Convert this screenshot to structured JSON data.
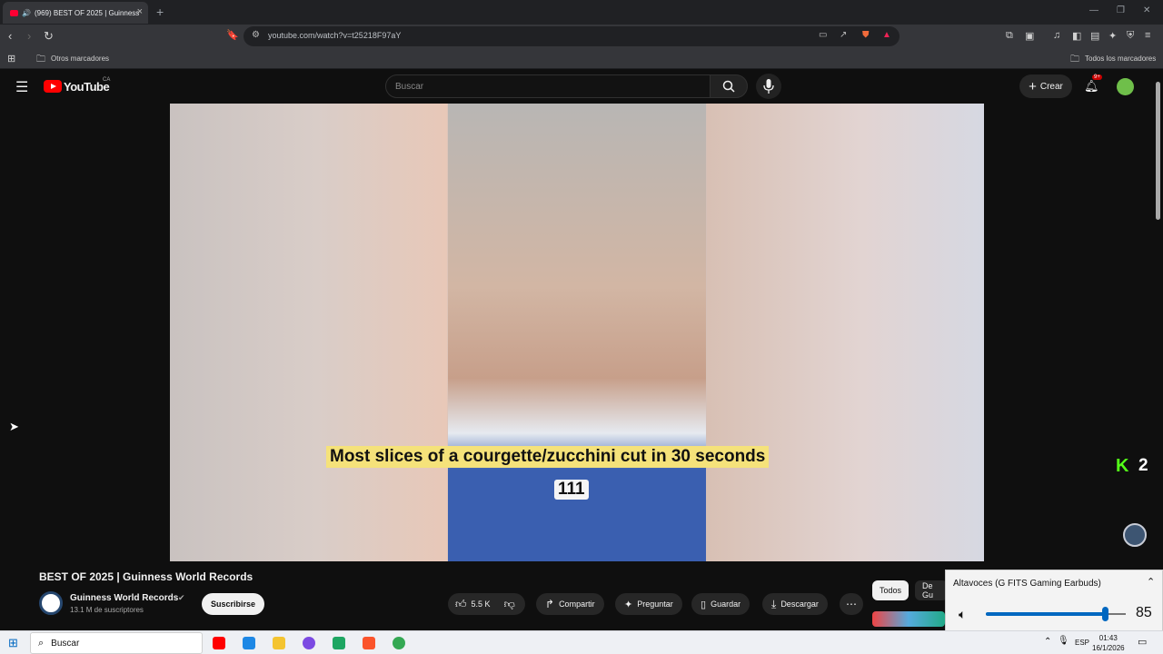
{
  "browser": {
    "tab_title": "(969) BEST OF 2025 | Guinness",
    "url": "youtube.com/watch?v=t25218F97aY",
    "bookmark_other": "Otros marcadores",
    "bookmark_all": "Todos los marcadores"
  },
  "youtube": {
    "logo_text": "YouTube",
    "region": "CA",
    "search_placeholder": "Buscar",
    "create_label": "Crear",
    "notif_badge": "9+"
  },
  "video": {
    "caption": "Most slices of a courgette/zucchini cut in 30 seconds",
    "counter": "111",
    "overlay_k": "K",
    "overlay_num": "2"
  },
  "info": {
    "title": "BEST OF 2025 | Guinness World Records",
    "channel": "Guinness World Records",
    "subs": "13.1 M de suscriptores",
    "subscribe": "Suscribirse",
    "likes": "5.5 K",
    "share": "Compartir",
    "ask": "Preguntar",
    "save": "Guardar",
    "download": "Descargar"
  },
  "chips": [
    "Todos",
    "De Gu"
  ],
  "volume": {
    "device": "Altavoces (G FITS Gaming Earbuds)",
    "level": 85
  },
  "taskbar": {
    "search": "Buscar",
    "lang": "ESP",
    "time": "01:43",
    "date": "16/1/2026"
  },
  "colors": {
    "youtube_red": "#ff0000",
    "accent_blue": "#0067c0",
    "caption_yellow": "#f5e27a"
  }
}
